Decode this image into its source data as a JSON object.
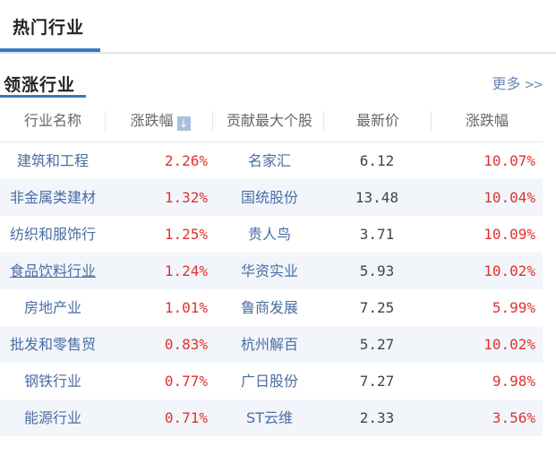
{
  "tab": {
    "label": "热门行业"
  },
  "section": {
    "title": "领涨行业",
    "more_label": "更多",
    "more_icon": "double-chevron-right-icon"
  },
  "columns": [
    "行业名称",
    "涨跌幅",
    "贡献最大个股",
    "最新价",
    "涨跌幅"
  ],
  "sort_icon": "arrow-down-icon",
  "colors": {
    "accent": "#3a78c0",
    "up": "#e03131",
    "link": "#4a6da3",
    "row_alt": "#f2f6fb"
  },
  "rows": [
    {
      "industry": "建筑和工程",
      "pct": "2.26%",
      "stock": "名家汇",
      "price": "6.12",
      "change": "10.07%"
    },
    {
      "industry": "非金属类建材",
      "pct": "1.32%",
      "stock": "国统股份",
      "price": "13.48",
      "change": "10.04%"
    },
    {
      "industry": "纺织和服饰行",
      "pct": "1.25%",
      "stock": "贵人鸟",
      "price": "3.71",
      "change": "10.09%"
    },
    {
      "industry": "食品饮料行业",
      "pct": "1.24%",
      "stock": "华资实业",
      "price": "5.93",
      "change": "10.02%"
    },
    {
      "industry": "房地产业",
      "pct": "1.01%",
      "stock": "鲁商发展",
      "price": "7.25",
      "change": "5.99%"
    },
    {
      "industry": "批发和零售贸",
      "pct": "0.83%",
      "stock": "杭州解百",
      "price": "5.27",
      "change": "10.02%"
    },
    {
      "industry": "钢铁行业",
      "pct": "0.77%",
      "stock": "广日股份",
      "price": "7.27",
      "change": "9.98%"
    },
    {
      "industry": "能源行业",
      "pct": "0.71%",
      "stock": "ST云维",
      "price": "2.33",
      "change": "3.56%"
    }
  ]
}
